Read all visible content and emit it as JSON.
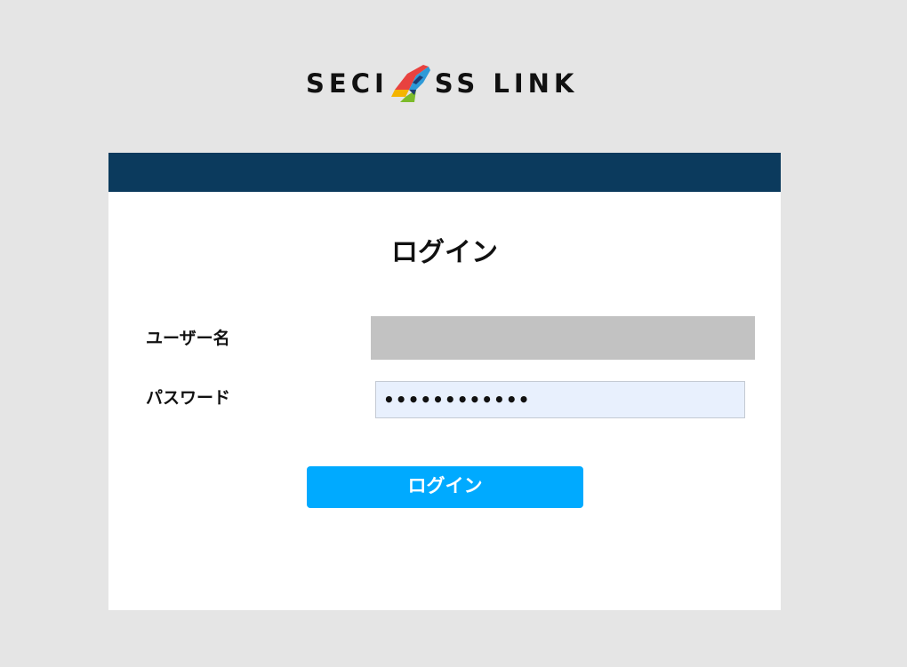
{
  "logo": {
    "text_left": "SECI",
    "text_right": "SS LINK",
    "colors": {
      "red": "#e8423f",
      "blue": "#2d9ad8",
      "yellow": "#f4b400",
      "green": "#7cbb2a",
      "navy": "#1d3c72"
    }
  },
  "header": {
    "color": "#0b3a5d"
  },
  "login": {
    "title": "ログイン",
    "username_label": "ユーザー名",
    "username_value": "",
    "password_label": "パスワード",
    "password_value": "••••••••••••",
    "button_label": "ログイン",
    "button_color": "#00aaff"
  }
}
